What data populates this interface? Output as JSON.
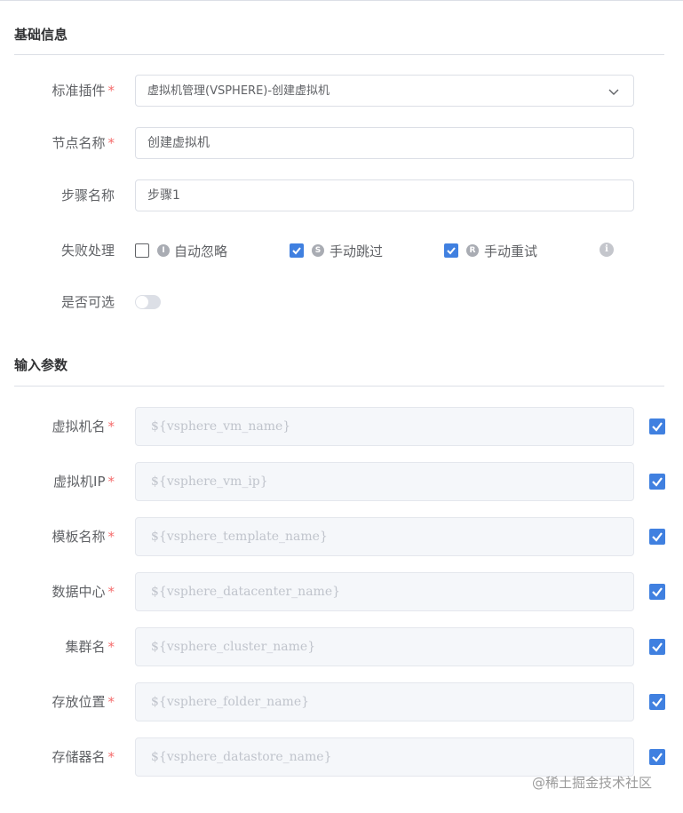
{
  "basic_section": {
    "title": "基础信息"
  },
  "plugin": {
    "label": "标准插件",
    "value": "虚拟机管理(VSPHERE)-创建虚拟机"
  },
  "node_name": {
    "label": "节点名称",
    "value": "创建虚拟机"
  },
  "step_name": {
    "label": "步骤名称",
    "value": "步骤1"
  },
  "failure_handling": {
    "label": "失败处理",
    "options": [
      {
        "icon_letter": "I",
        "label": "自动忽略",
        "checked": false
      },
      {
        "icon_letter": "S",
        "label": "手动跳过",
        "checked": true
      },
      {
        "icon_letter": "R",
        "label": "手动重试",
        "checked": true
      }
    ],
    "info_glyph": "i"
  },
  "optional": {
    "label": "是否可选",
    "enabled": false
  },
  "input_section": {
    "title": "输入参数"
  },
  "inputs": [
    {
      "label": "虚拟机名",
      "value": "${vsphere_vm_name}",
      "checked": true
    },
    {
      "label": "虚拟机IP",
      "value": "${vsphere_vm_ip}",
      "checked": true
    },
    {
      "label": "模板名称",
      "value": "${vsphere_template_name}",
      "checked": true
    },
    {
      "label": "数据中心",
      "value": "${vsphere_datacenter_name}",
      "checked": true
    },
    {
      "label": "集群名",
      "value": "${vsphere_cluster_name}",
      "checked": true
    },
    {
      "label": "存放位置",
      "value": "${vsphere_folder_name}",
      "checked": true
    },
    {
      "label": "存储器名",
      "value": "${vsphere_datastore_name}",
      "checked": true
    }
  ],
  "required_mark": "*",
  "watermark": "@稀土掘金技术社区",
  "colors": {
    "accent": "#4080e0",
    "required": "#f56c6c",
    "disabled_bg": "#f5f7fa"
  }
}
